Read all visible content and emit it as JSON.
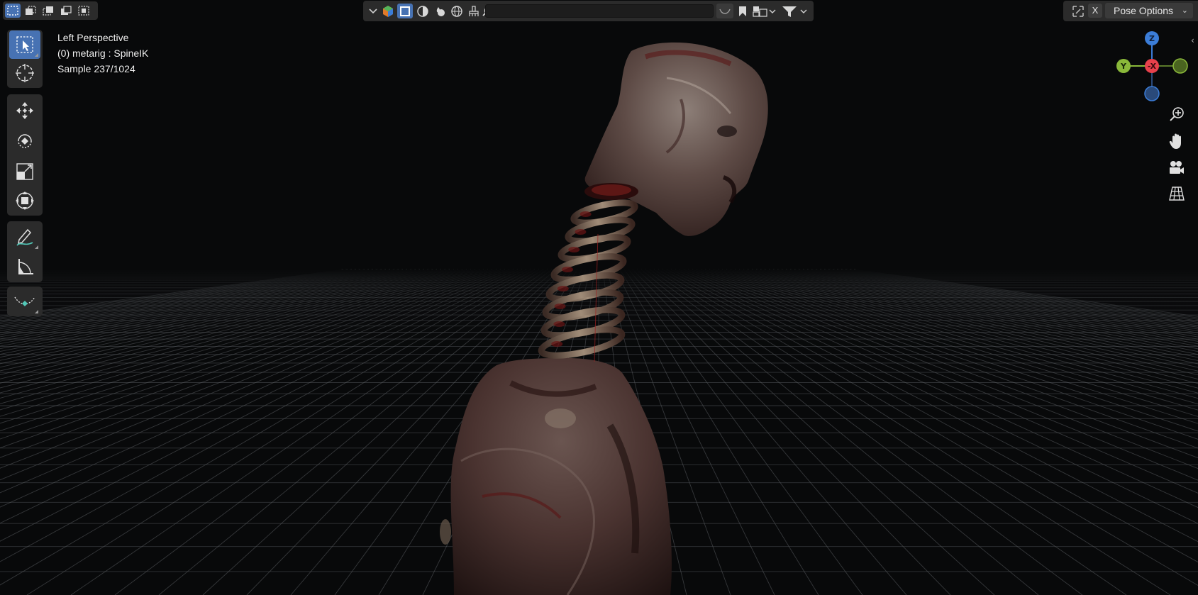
{
  "viewport": {
    "view_name": "Left Perspective",
    "object_info": "(0) metarig : SpineIK",
    "render_sample": "Sample 237/1024"
  },
  "header_left": {
    "select_modes": [
      {
        "icon": "select-new-icon",
        "active": true
      },
      {
        "icon": "select-extend-icon",
        "active": false
      },
      {
        "icon": "select-subtract-icon",
        "active": false
      },
      {
        "icon": "select-invert-icon",
        "active": false
      },
      {
        "icon": "select-intersect-icon",
        "active": false
      }
    ]
  },
  "header_center": {
    "items": [
      "dropdown-chevron-icon",
      "material-preview-icon",
      "solid-shading-icon",
      "wireframe-shading-icon",
      "rendered-shading-icon",
      "world-icon",
      "brush-icon",
      "search-icon",
      "overlay-icon",
      "bookmark-icon",
      "layout-icon",
      "filter-icon"
    ]
  },
  "header_right": {
    "close_label": "X",
    "pose_options_label": "Pose Options"
  },
  "toolbar": {
    "tools": [
      "select-box-icon",
      "cursor-icon",
      "move-icon",
      "rotate-icon",
      "scale-icon",
      "transform-icon",
      "annotate-icon",
      "measure-icon",
      "bone-roll-icon"
    ],
    "active_tool": "select-box-icon"
  },
  "navigation_gizmo": {
    "axes": {
      "z": "Z",
      "y": "Y",
      "neg_x": "-X"
    },
    "colors": {
      "x": "#e8414c",
      "y": "#8ab83a",
      "z": "#3b7dd8"
    }
  },
  "navigation_buttons": [
    "zoom-icon",
    "pan-hand-icon",
    "camera-view-icon",
    "grid-view-icon"
  ],
  "colors": {
    "accent": "#4772b3",
    "header_bg": "#2b2b2b",
    "viewport_bg": "#08090a"
  }
}
